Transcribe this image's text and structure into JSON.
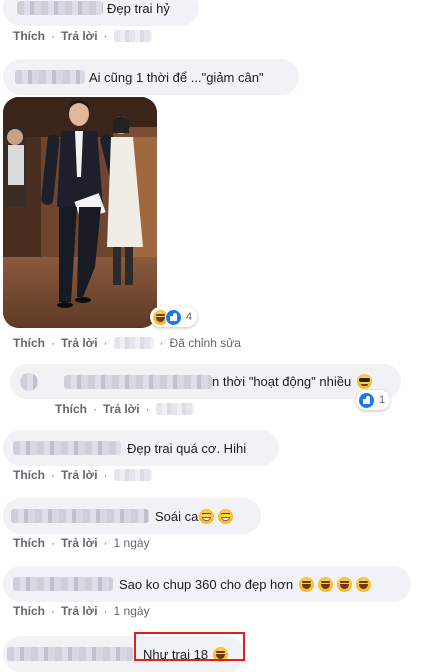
{
  "labels": {
    "like": "Thích",
    "reply": "Trả lời",
    "edited": "Đã chỉnh sửa",
    "one_day": "1 ngày"
  },
  "comments": [
    {
      "text": "Đẹp trai hỷ"
    },
    {
      "text": "Ai cũng 1 thời để ...\"giảm cân\"",
      "reactions": {
        "icons": [
          "laugh-emoji",
          "like-icon"
        ],
        "count": "4"
      }
    },
    {
      "text": "n thời \"hoạt động\" nhiều",
      "emoji": [
        "cool-emoji"
      ],
      "reactions": {
        "icons": [
          "like-icon"
        ],
        "count": "1"
      }
    },
    {
      "text": "Đẹp trai quá cơ. Hihi"
    },
    {
      "text": "Soái ca",
      "emoji": [
        "grin-emoji",
        "grin-emoji"
      ]
    },
    {
      "text": "Sao ko chup 360 cho đẹp hơn",
      "emoji": [
        "laugh-emoji",
        "laugh-emoji",
        "laugh-emoji",
        "laugh-emoji"
      ]
    },
    {
      "text": "Như trai 18",
      "emoji": [
        "laugh-emoji"
      ]
    }
  ],
  "colors": {
    "bubble": "#f0f2f5",
    "action_text": "#65676b",
    "like_blue": "#1877f2",
    "highlight_red": "#e02020"
  }
}
